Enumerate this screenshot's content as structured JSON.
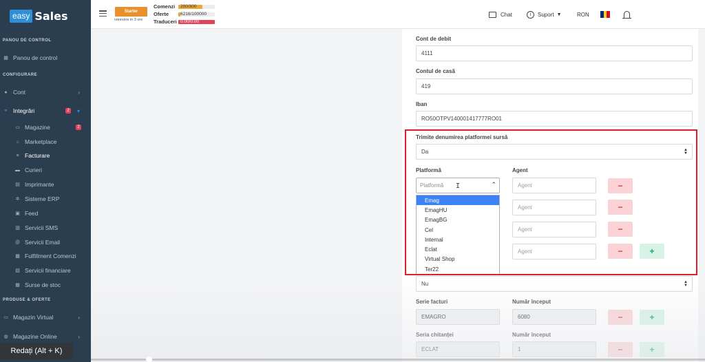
{
  "brand": {
    "box": "easy",
    "text": "Sales"
  },
  "sidebar": {
    "sections": {
      "panou": "PANOU DE CONTROL",
      "configurare": "CONFIGURARE",
      "produse": "PRODUSE & OFERTE"
    },
    "items": {
      "panou_control": "Panou de control",
      "cont": "Cont",
      "integrari": "Integrări",
      "integrari_badge": "2",
      "magazine": "Magazine",
      "magazine_badge": "2",
      "marketplace": "Marketplace",
      "facturare": "Facturare",
      "curieri": "Curieri",
      "imprimante": "Imprimante",
      "sisteme_erp": "Sisteme ERP",
      "feed": "Feed",
      "servicii_sms": "Servicii SMS",
      "servicii_email": "Servicii Email",
      "fulfillment": "Fulfillment Comenzi",
      "servicii_financiare": "Servicii financiare",
      "surse_stoc": "Surse de stoc",
      "magazin_virtual": "Magazin Virtual",
      "magazine_online": "Magazine Online"
    }
  },
  "topbar": {
    "plan_button": "Starter",
    "renew_text": "reinnoire in 3 ore",
    "quotas": [
      {
        "label": "Comenzi",
        "text": "200/300",
        "fill": 0.667,
        "color": "#e8a93a"
      },
      {
        "label": "Oferte",
        "text": "6216/100000",
        "fill": 0.062,
        "color": "#e8a93a"
      },
      {
        "label": "Traduceri",
        "text": "0.00/0.00",
        "fill": 1.0,
        "color": "#e0435a"
      }
    ],
    "chat": "Chat",
    "suport": "Suport",
    "currency": "RON",
    "flag_colors": [
      "#002b7f",
      "#fcd116",
      "#ce1126"
    ]
  },
  "form": {
    "cont_debit_label": "Cont de debit",
    "cont_debit_value": "4111",
    "cont_casa_label": "Contul de casă",
    "cont_casa_value": "419",
    "iban_label": "Iban",
    "iban_value": "RO50OTPV140001417777RO01",
    "trimite_label": "Trimite denumirea platformei sursă",
    "trimite_value": "Da",
    "platforma_label": "Platformă",
    "agent_label": "Agent",
    "platforma_placeholder": "Platformă",
    "agent_placeholder": "Agent",
    "nu_value": "Nu",
    "serie_facturi_label": "Serie facturi",
    "numar_inceput_label": "Număr început",
    "serie_facturi_value": "EMAGRO",
    "numar_inceput_value": "6080",
    "serie_chitantei_label": "Seria chitanței",
    "numar_inceput2_label": "Număr început",
    "serie_chitantei_value": "ECLAT",
    "numar_inceput2_value": "1",
    "minus": "−",
    "plus": "+"
  },
  "dropdown_options": [
    "Emag",
    "EmagHU",
    "EmagBG",
    "Cel",
    "Internal",
    "Eclat",
    "Virtual Shop",
    "Ter22"
  ],
  "tooltip": "Redați (Alt + K)"
}
